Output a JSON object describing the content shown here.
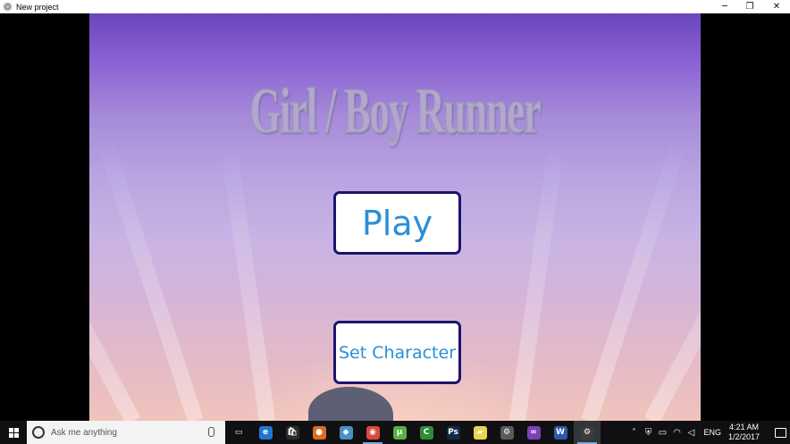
{
  "window": {
    "title": "New project",
    "controls": {
      "minimize": "─",
      "maximize": "❐",
      "close": "✕"
    }
  },
  "game": {
    "title": "Girl / Boy Runner",
    "buttons": {
      "play": "Play",
      "set_character": "Set Character"
    }
  },
  "taskbar": {
    "search_placeholder": "Ask me anything",
    "pinned": [
      {
        "name": "task-view-icon",
        "glyph": "▭",
        "color": "#101012"
      },
      {
        "name": "edge-icon",
        "glyph": "e",
        "color": "#1e78d2"
      },
      {
        "name": "store-icon",
        "glyph": "🛍",
        "color": "#2b2b2b"
      },
      {
        "name": "firefox-icon",
        "glyph": "●",
        "color": "#e06b1f"
      },
      {
        "name": "app-blue-icon",
        "glyph": "◆",
        "color": "#4b8fc7"
      },
      {
        "name": "chrome-icon",
        "glyph": "◉",
        "color": "#d94a3a"
      },
      {
        "name": "utorrent-icon",
        "glyph": "µ",
        "color": "#57b23f"
      },
      {
        "name": "camtasia-icon",
        "glyph": "C",
        "color": "#2f8c3a"
      },
      {
        "name": "photoshop-icon",
        "glyph": "Ps",
        "color": "#0f2a4a"
      },
      {
        "name": "sticky-notes-icon",
        "glyph": "▰",
        "color": "#e9d64c"
      },
      {
        "name": "settings-icon",
        "glyph": "⚙",
        "color": "#5a5a5a"
      },
      {
        "name": "visual-studio-icon",
        "glyph": "∞",
        "color": "#7b42b7"
      },
      {
        "name": "word-icon",
        "glyph": "W",
        "color": "#2b5aa6"
      },
      {
        "name": "unity-icon",
        "glyph": "⚙",
        "color": "#3c3c3c"
      }
    ],
    "tray": {
      "language": "ENG",
      "time": "4:21 AM",
      "date": "1/2/2017"
    }
  }
}
